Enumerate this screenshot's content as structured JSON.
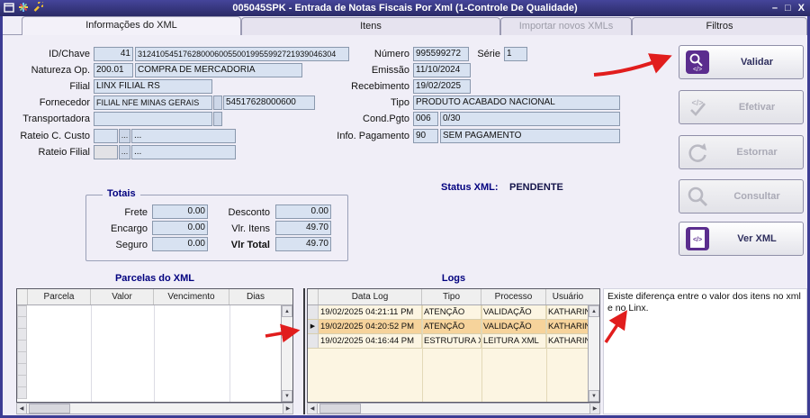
{
  "titlebar": {
    "title": "005045SPK - Entrada de Notas Fiscais Por Xml (1-Controle De Qualidade)",
    "minimize": "–",
    "maximize": "□",
    "close": "X"
  },
  "tabs": [
    {
      "label": "Informações do XML"
    },
    {
      "label": "Itens"
    },
    {
      "label": "Importar novos XMLs"
    },
    {
      "label": "Filtros"
    }
  ],
  "form": {
    "id_chave_label": "ID/Chave",
    "id_value": "41",
    "chave_value": "31241054517628000600550019955992721939046304",
    "natureza_label": "Natureza Op.",
    "natureza_code": "200.01",
    "natureza_desc": "COMPRA DE MERCADORIA",
    "filial_label": "Filial",
    "filial_value": "LINX FILIAL RS",
    "fornecedor_label": "Fornecedor",
    "fornecedor_value": "FILIAL NFE MINAS GERAIS",
    "fornecedor_cnpj": "54517628000600",
    "transportadora_label": "Transportadora",
    "transportadora_value": "",
    "rateio_custo_label": "Rateio C. Custo",
    "rateio_custo_value": "",
    "rateio_custo_browse": "...",
    "rateio_custo_desc": "...",
    "rateio_filial_label": "Rateio Filial",
    "rateio_filial_value": "",
    "rateio_filial_browse": "...",
    "rateio_filial_desc": "...",
    "numero_label": "Número",
    "numero_value": "995599272",
    "serie_label": "Série",
    "serie_value": "1",
    "emissao_label": "Emissão",
    "emissao_value": "11/10/2024",
    "recebimento_label": "Recebimento",
    "recebimento_value": "19/02/2025",
    "tipo_label": "Tipo",
    "tipo_value": "PRODUTO ACABADO NACIONAL",
    "cond_pgto_label": "Cond.Pgto",
    "cond_pgto_code": "006",
    "cond_pgto_value": "0/30",
    "info_pag_label": "Info. Pagamento",
    "info_pag_code": "90",
    "info_pag_value": "SEM PAGAMENTO",
    "status_label": "Status XML:",
    "status_value": "PENDENTE"
  },
  "totais": {
    "title": "Totais",
    "frete_label": "Frete",
    "frete_value": "0.00",
    "desconto_label": "Desconto",
    "desconto_value": "0.00",
    "encargo_label": "Encargo",
    "encargo_value": "0.00",
    "vlr_itens_label": "Vlr. Itens",
    "vlr_itens_value": "49.70",
    "seguro_label": "Seguro",
    "seguro_value": "0.00",
    "vlr_total_label": "Vlr Total",
    "vlr_total_value": "49.70"
  },
  "actions": [
    {
      "label": "Validar",
      "enabled": true
    },
    {
      "label": "Efetivar",
      "enabled": false
    },
    {
      "label": "Estornar",
      "enabled": false
    },
    {
      "label": "Consultar",
      "enabled": false
    },
    {
      "label": "Ver XML",
      "enabled": true
    }
  ],
  "grids": {
    "parcelas": {
      "title": "Parcelas do XML",
      "columns": [
        "Parcela",
        "Valor",
        "Vencimento",
        "Dias"
      ]
    },
    "logs": {
      "title": "Logs",
      "columns": [
        "Data Log",
        "Tipo",
        "Processo",
        "Usuário"
      ],
      "rows": [
        {
          "data": "19/02/2025 04:21:11 PM",
          "tipo": "ATENÇÃO",
          "processo": "VALIDAÇÃO",
          "usuario": "KATHARINA"
        },
        {
          "data": "19/02/2025 04:20:52 PM",
          "tipo": "ATENÇÃO",
          "processo": "VALIDAÇÃO",
          "usuario": "KATHARINA"
        },
        {
          "data": "19/02/2025 04:16:44 PM",
          "tipo": "ESTRUTURA XML OK",
          "processo": "LEITURA XML",
          "usuario": "KATHARINA"
        }
      ]
    }
  },
  "message": {
    "text": "Existe diferença entre o valor dos itens no xml e no Linx."
  },
  "colors": {
    "titlebar": "#34347c",
    "window_border": "#3c3c94",
    "accent_purple": "#5b2d8e",
    "status_text": "#00007f",
    "selected_row": "#f6d39b",
    "log_row_bg": "#fcf5e2",
    "annotation_red": "#e11d1d"
  }
}
